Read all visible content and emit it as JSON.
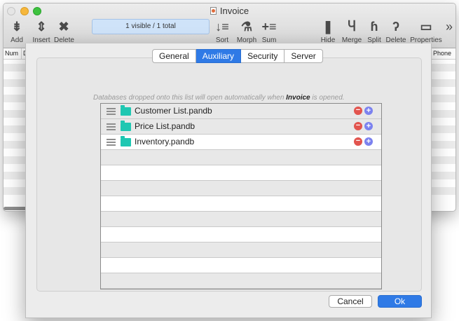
{
  "window": {
    "title": "Invoice",
    "record_count": "1 visible / 1 total"
  },
  "toolbar": {
    "left": [
      {
        "id": "add",
        "label": "Add",
        "icon": "add-record-icon",
        "glyph": "⇟"
      },
      {
        "id": "insert",
        "label": "Insert",
        "icon": "insert-record-icon",
        "glyph": "⇕"
      },
      {
        "id": "delete",
        "label": "Delete",
        "icon": "delete-record-icon",
        "glyph": "✖"
      }
    ],
    "right": [
      {
        "id": "sort",
        "label": "Sort",
        "icon": "sort-icon",
        "glyph": "↓≡"
      },
      {
        "id": "morph",
        "label": "Morph",
        "icon": "flask-icon",
        "glyph": "⚗"
      },
      {
        "id": "sum",
        "label": "Sum",
        "icon": "sum-icon",
        "glyph": "+≡"
      },
      {
        "id": "hide",
        "label": "Hide",
        "icon": "bookmark-icon",
        "glyph": "❚"
      },
      {
        "id": "merge",
        "label": "Merge",
        "icon": "merge-icon",
        "glyph": "Ⴗ"
      },
      {
        "id": "split",
        "label": "Split",
        "icon": "split-icon",
        "glyph": "ɦ"
      },
      {
        "id": "delete_field",
        "label": "Delete",
        "icon": "delete-field-icon",
        "glyph": "ʔ"
      },
      {
        "id": "properties",
        "label": "Properties",
        "icon": "properties-icon",
        "glyph": "▭"
      }
    ],
    "overflow_glyph": "»"
  },
  "columns": [
    "Num",
    "Da",
    "Phone"
  ],
  "dialog": {
    "tabs": [
      {
        "label": "General",
        "active": false
      },
      {
        "label": "Auxiliary",
        "active": true
      },
      {
        "label": "Security",
        "active": false
      },
      {
        "label": "Server",
        "active": false
      }
    ],
    "hint_before": "Databases dropped onto this list will open automatically when ",
    "hint_bold": "Invoice",
    "hint_after": " is opened.",
    "databases": [
      "Customer List.pandb",
      "Price List.pandb",
      "Inventory.pandb"
    ],
    "remove_glyph": "−",
    "add_glyph": "+",
    "cancel_label": "Cancel",
    "ok_label": "Ok"
  },
  "colors": {
    "accent": "#2f7ae6",
    "folder": "#1fc7b2",
    "remove": "#e2544e",
    "add": "#7c82ef"
  }
}
